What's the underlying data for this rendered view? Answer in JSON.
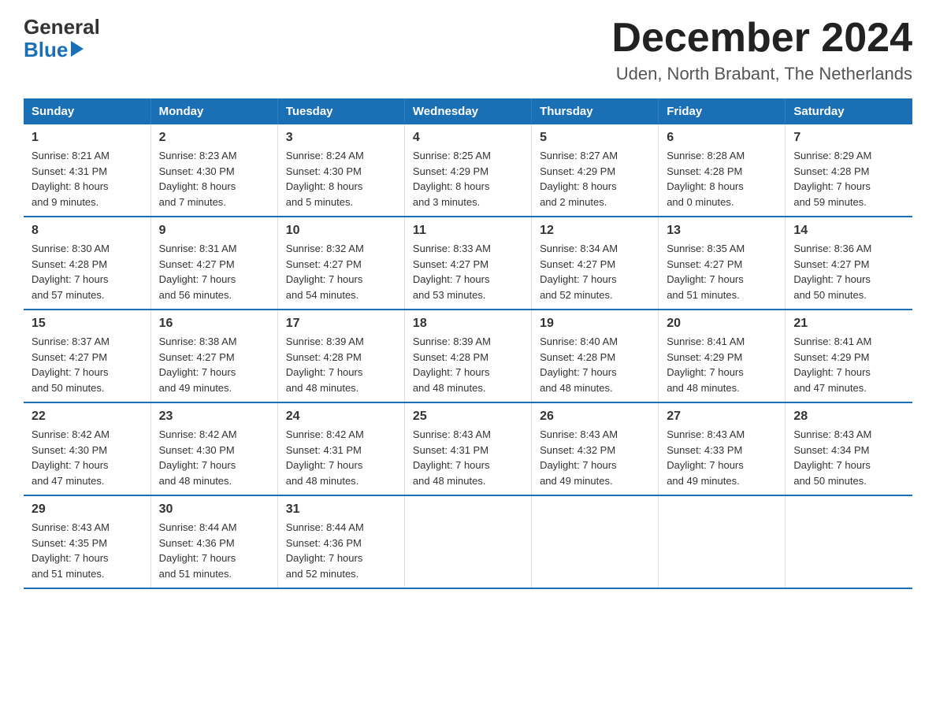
{
  "logo": {
    "general": "General",
    "blue": "Blue"
  },
  "header": {
    "title": "December 2024",
    "subtitle": "Uden, North Brabant, The Netherlands"
  },
  "weekdays": [
    "Sunday",
    "Monday",
    "Tuesday",
    "Wednesday",
    "Thursday",
    "Friday",
    "Saturday"
  ],
  "weeks": [
    [
      {
        "day": "1",
        "sunrise": "8:21 AM",
        "sunset": "4:31 PM",
        "daylight": "8 hours and 9 minutes."
      },
      {
        "day": "2",
        "sunrise": "8:23 AM",
        "sunset": "4:30 PM",
        "daylight": "8 hours and 7 minutes."
      },
      {
        "day": "3",
        "sunrise": "8:24 AM",
        "sunset": "4:30 PM",
        "daylight": "8 hours and 5 minutes."
      },
      {
        "day": "4",
        "sunrise": "8:25 AM",
        "sunset": "4:29 PM",
        "daylight": "8 hours and 3 minutes."
      },
      {
        "day": "5",
        "sunrise": "8:27 AM",
        "sunset": "4:29 PM",
        "daylight": "8 hours and 2 minutes."
      },
      {
        "day": "6",
        "sunrise": "8:28 AM",
        "sunset": "4:28 PM",
        "daylight": "8 hours and 0 minutes."
      },
      {
        "day": "7",
        "sunrise": "8:29 AM",
        "sunset": "4:28 PM",
        "daylight": "7 hours and 59 minutes."
      }
    ],
    [
      {
        "day": "8",
        "sunrise": "8:30 AM",
        "sunset": "4:28 PM",
        "daylight": "7 hours and 57 minutes."
      },
      {
        "day": "9",
        "sunrise": "8:31 AM",
        "sunset": "4:27 PM",
        "daylight": "7 hours and 56 minutes."
      },
      {
        "day": "10",
        "sunrise": "8:32 AM",
        "sunset": "4:27 PM",
        "daylight": "7 hours and 54 minutes."
      },
      {
        "day": "11",
        "sunrise": "8:33 AM",
        "sunset": "4:27 PM",
        "daylight": "7 hours and 53 minutes."
      },
      {
        "day": "12",
        "sunrise": "8:34 AM",
        "sunset": "4:27 PM",
        "daylight": "7 hours and 52 minutes."
      },
      {
        "day": "13",
        "sunrise": "8:35 AM",
        "sunset": "4:27 PM",
        "daylight": "7 hours and 51 minutes."
      },
      {
        "day": "14",
        "sunrise": "8:36 AM",
        "sunset": "4:27 PM",
        "daylight": "7 hours and 50 minutes."
      }
    ],
    [
      {
        "day": "15",
        "sunrise": "8:37 AM",
        "sunset": "4:27 PM",
        "daylight": "7 hours and 50 minutes."
      },
      {
        "day": "16",
        "sunrise": "8:38 AM",
        "sunset": "4:27 PM",
        "daylight": "7 hours and 49 minutes."
      },
      {
        "day": "17",
        "sunrise": "8:39 AM",
        "sunset": "4:28 PM",
        "daylight": "7 hours and 48 minutes."
      },
      {
        "day": "18",
        "sunrise": "8:39 AM",
        "sunset": "4:28 PM",
        "daylight": "7 hours and 48 minutes."
      },
      {
        "day": "19",
        "sunrise": "8:40 AM",
        "sunset": "4:28 PM",
        "daylight": "7 hours and 48 minutes."
      },
      {
        "day": "20",
        "sunrise": "8:41 AM",
        "sunset": "4:29 PM",
        "daylight": "7 hours and 48 minutes."
      },
      {
        "day": "21",
        "sunrise": "8:41 AM",
        "sunset": "4:29 PM",
        "daylight": "7 hours and 47 minutes."
      }
    ],
    [
      {
        "day": "22",
        "sunrise": "8:42 AM",
        "sunset": "4:30 PM",
        "daylight": "7 hours and 47 minutes."
      },
      {
        "day": "23",
        "sunrise": "8:42 AM",
        "sunset": "4:30 PM",
        "daylight": "7 hours and 48 minutes."
      },
      {
        "day": "24",
        "sunrise": "8:42 AM",
        "sunset": "4:31 PM",
        "daylight": "7 hours and 48 minutes."
      },
      {
        "day": "25",
        "sunrise": "8:43 AM",
        "sunset": "4:31 PM",
        "daylight": "7 hours and 48 minutes."
      },
      {
        "day": "26",
        "sunrise": "8:43 AM",
        "sunset": "4:32 PM",
        "daylight": "7 hours and 49 minutes."
      },
      {
        "day": "27",
        "sunrise": "8:43 AM",
        "sunset": "4:33 PM",
        "daylight": "7 hours and 49 minutes."
      },
      {
        "day": "28",
        "sunrise": "8:43 AM",
        "sunset": "4:34 PM",
        "daylight": "7 hours and 50 minutes."
      }
    ],
    [
      {
        "day": "29",
        "sunrise": "8:43 AM",
        "sunset": "4:35 PM",
        "daylight": "7 hours and 51 minutes."
      },
      {
        "day": "30",
        "sunrise": "8:44 AM",
        "sunset": "4:36 PM",
        "daylight": "7 hours and 51 minutes."
      },
      {
        "day": "31",
        "sunrise": "8:44 AM",
        "sunset": "4:36 PM",
        "daylight": "7 hours and 52 minutes."
      },
      null,
      null,
      null,
      null
    ]
  ],
  "labels": {
    "sunrise": "Sunrise:",
    "sunset": "Sunset:",
    "daylight": "Daylight:"
  }
}
